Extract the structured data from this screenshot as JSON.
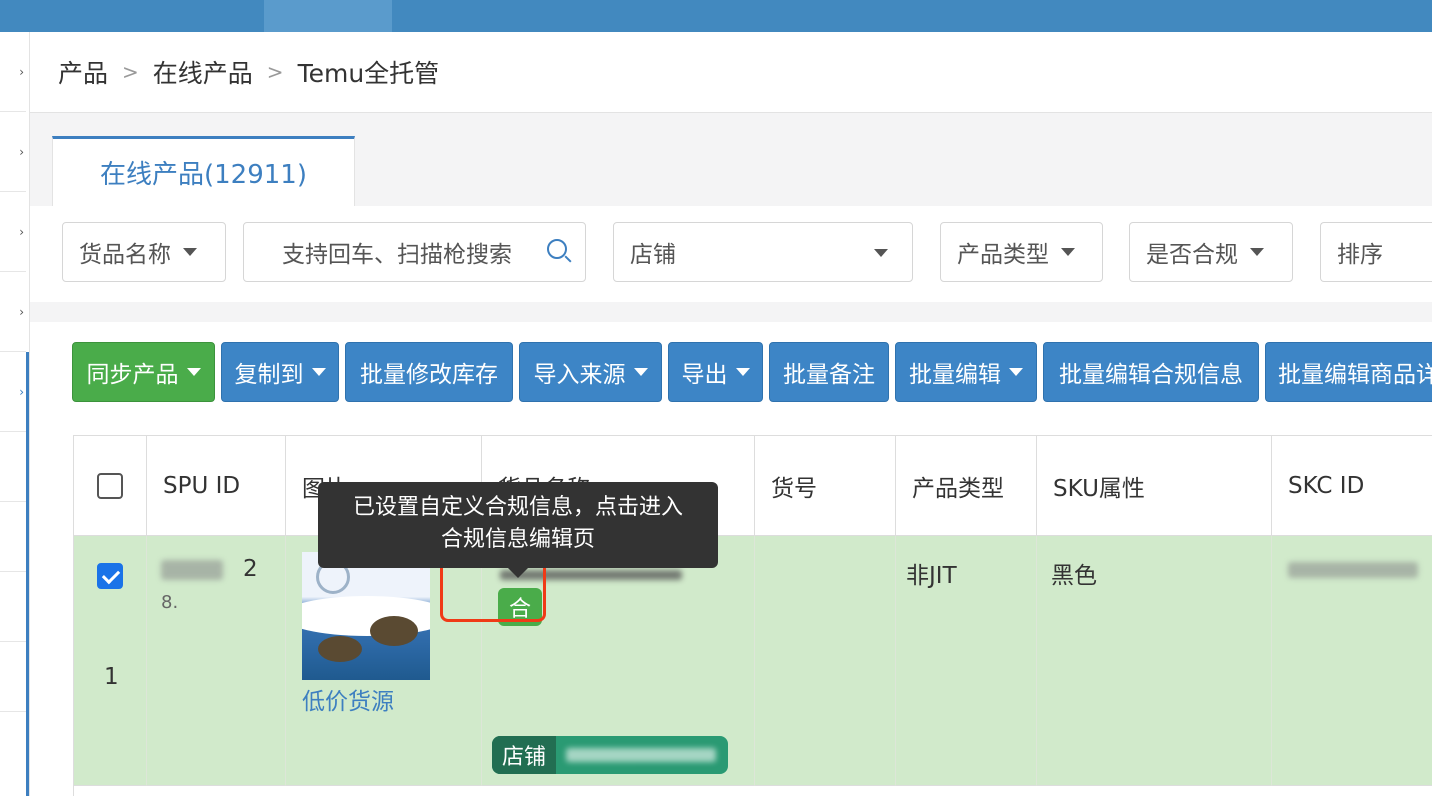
{
  "breadcrumb": {
    "items": [
      "产品",
      "在线产品",
      "Temu全托管"
    ],
    "separator": ">"
  },
  "tab": {
    "label": "在线产品(12911)"
  },
  "filters": {
    "goods_name_select": "货品名称",
    "search_placeholder": "支持回车、扫描枪搜索",
    "store_select": "店铺",
    "product_type_select": "产品类型",
    "compliance_select": "是否合规",
    "sort_select": "排序"
  },
  "toolbar": {
    "sync": "同步产品",
    "copy_to": "复制到",
    "batch_stock": "批量修改库存",
    "import_source": "导入来源",
    "export": "导出",
    "batch_note": "批量备注",
    "batch_edit": "批量编辑",
    "batch_compliance": "批量编辑合规信息",
    "batch_goods": "批量编辑商品详"
  },
  "table": {
    "headers": [
      "SPU ID",
      "图片",
      "货品名称",
      "货号",
      "产品类型",
      "SKU属性",
      "SKC ID"
    ],
    "rows": [
      {
        "index": "1",
        "spu_visible_1": "2",
        "spu_visible_2": "8.",
        "low_price_link": "低价货源",
        "compliance_badge": "合",
        "store_tag_label": "店铺",
        "product_type": "非JIT",
        "sku_attr": "黑色"
      }
    ]
  },
  "tooltip": {
    "line1": "已设置自定义合规信息，点击进入",
    "line2": "合规信息编辑页"
  },
  "colors": {
    "topbar": "#4289bf",
    "primary_button": "#3d85c6",
    "success_button": "#4aac4a",
    "selected_row": "#d1eacb",
    "highlight_box": "#f03a17"
  }
}
